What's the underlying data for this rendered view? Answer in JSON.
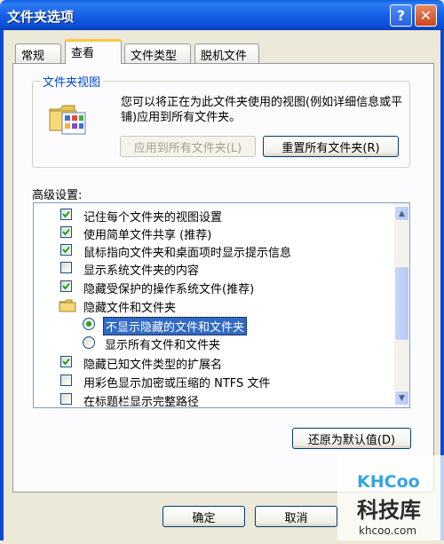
{
  "window": {
    "title": "文件夹选项",
    "help_label": "?",
    "close_label": "✕"
  },
  "tabs": [
    {
      "label": "常规"
    },
    {
      "label": "查看"
    },
    {
      "label": "文件类型"
    },
    {
      "label": "脱机文件"
    }
  ],
  "folder_view": {
    "title": "文件夹视图",
    "description": "您可以将正在为此文件夹使用的视图(例如详细信息或平铺)应用到所有文件夹。",
    "apply_all_label": "应用到所有文件夹(L)",
    "reset_all_label": "重置所有文件夹(R)",
    "icon": "folder-view-icon"
  },
  "advanced": {
    "label": "高级设置:",
    "items": [
      {
        "type": "checkbox",
        "checked": true,
        "label": "记住每个文件夹的视图设置"
      },
      {
        "type": "checkbox",
        "checked": true,
        "label": "使用简单文件共享 (推荐)"
      },
      {
        "type": "checkbox",
        "checked": true,
        "label": "鼠标指向文件夹和桌面项时显示提示信息"
      },
      {
        "type": "checkbox",
        "checked": false,
        "label": "显示系统文件夹的内容"
      },
      {
        "type": "checkbox",
        "checked": true,
        "label": "隐藏受保护的操作系统文件(推荐)"
      },
      {
        "type": "folder",
        "label": "隐藏文件和文件夹"
      },
      {
        "type": "radio",
        "checked": true,
        "selected": true,
        "label": "不显示隐藏的文件和文件夹"
      },
      {
        "type": "radio",
        "checked": false,
        "label": "显示所有文件和文件夹"
      },
      {
        "type": "checkbox",
        "checked": true,
        "label": "隐藏已知文件类型的扩展名"
      },
      {
        "type": "checkbox",
        "checked": false,
        "label": "用彩色显示加密或压缩的 NTFS 文件"
      },
      {
        "type": "checkbox",
        "checked": false,
        "label": "在标题栏显示完整路径"
      }
    ],
    "restore_defaults_label": "还原为默认值(D)"
  },
  "footer": {
    "ok_label": "确定",
    "cancel_label": "取消"
  },
  "watermark": {
    "brand": "KHCoo",
    "name": "科技库",
    "url": "khcoo.com"
  },
  "colors": {
    "title_bar": "#1660e6",
    "selection": "#316ac5",
    "accent_tab": "#ffc83c"
  }
}
